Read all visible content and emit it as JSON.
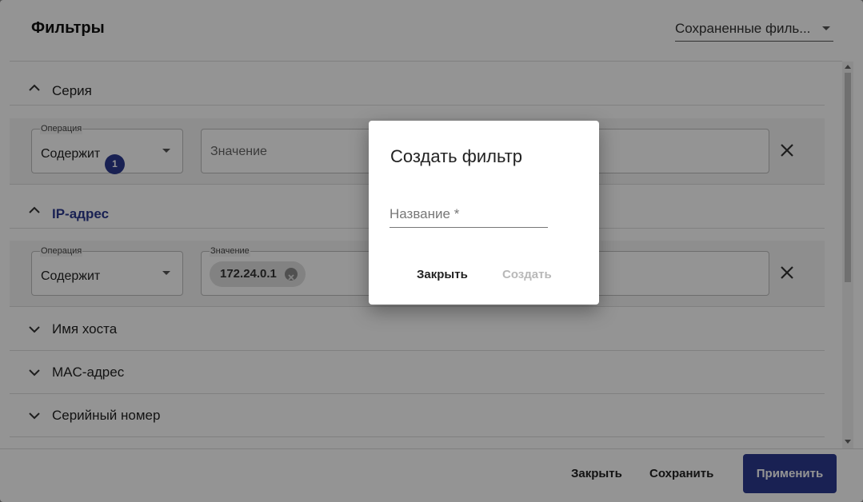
{
  "header": {
    "title": "Фильтры",
    "saved_filters_label": "Сохраненные филь..."
  },
  "sections": [
    {
      "label": "Серия",
      "expanded": true,
      "operation_label": "Операция",
      "operation_value": "Содержит",
      "value_placeholder": "Значение"
    },
    {
      "label": "IP-адрес",
      "expanded": true,
      "badge": "1",
      "operation_label": "Операция",
      "operation_value": "Содержит",
      "value_label": "Значение",
      "chip": "172.24.0.1"
    },
    {
      "label": "Имя хоста",
      "expanded": false
    },
    {
      "label": "MAC-адрес",
      "expanded": false
    },
    {
      "label": "Серийный номер",
      "expanded": false
    }
  ],
  "footer": {
    "close_label": "Закрыть",
    "save_label": "Сохранить",
    "apply_label": "Применить"
  },
  "dialog": {
    "title": "Создать фильтр",
    "name_placeholder": "Название *",
    "name_value": "",
    "close_label": "Закрыть",
    "create_label": "Создать"
  },
  "colors": {
    "accent": "#2c3a8f",
    "overlay": "rgba(0,0,0,0.42)"
  },
  "icons": {
    "collapse": "chevron-up-icon",
    "expand": "chevron-down-icon",
    "dropdown": "triangle-down-icon",
    "clear": "close-icon",
    "chip_remove": "cancel-circle-icon"
  }
}
